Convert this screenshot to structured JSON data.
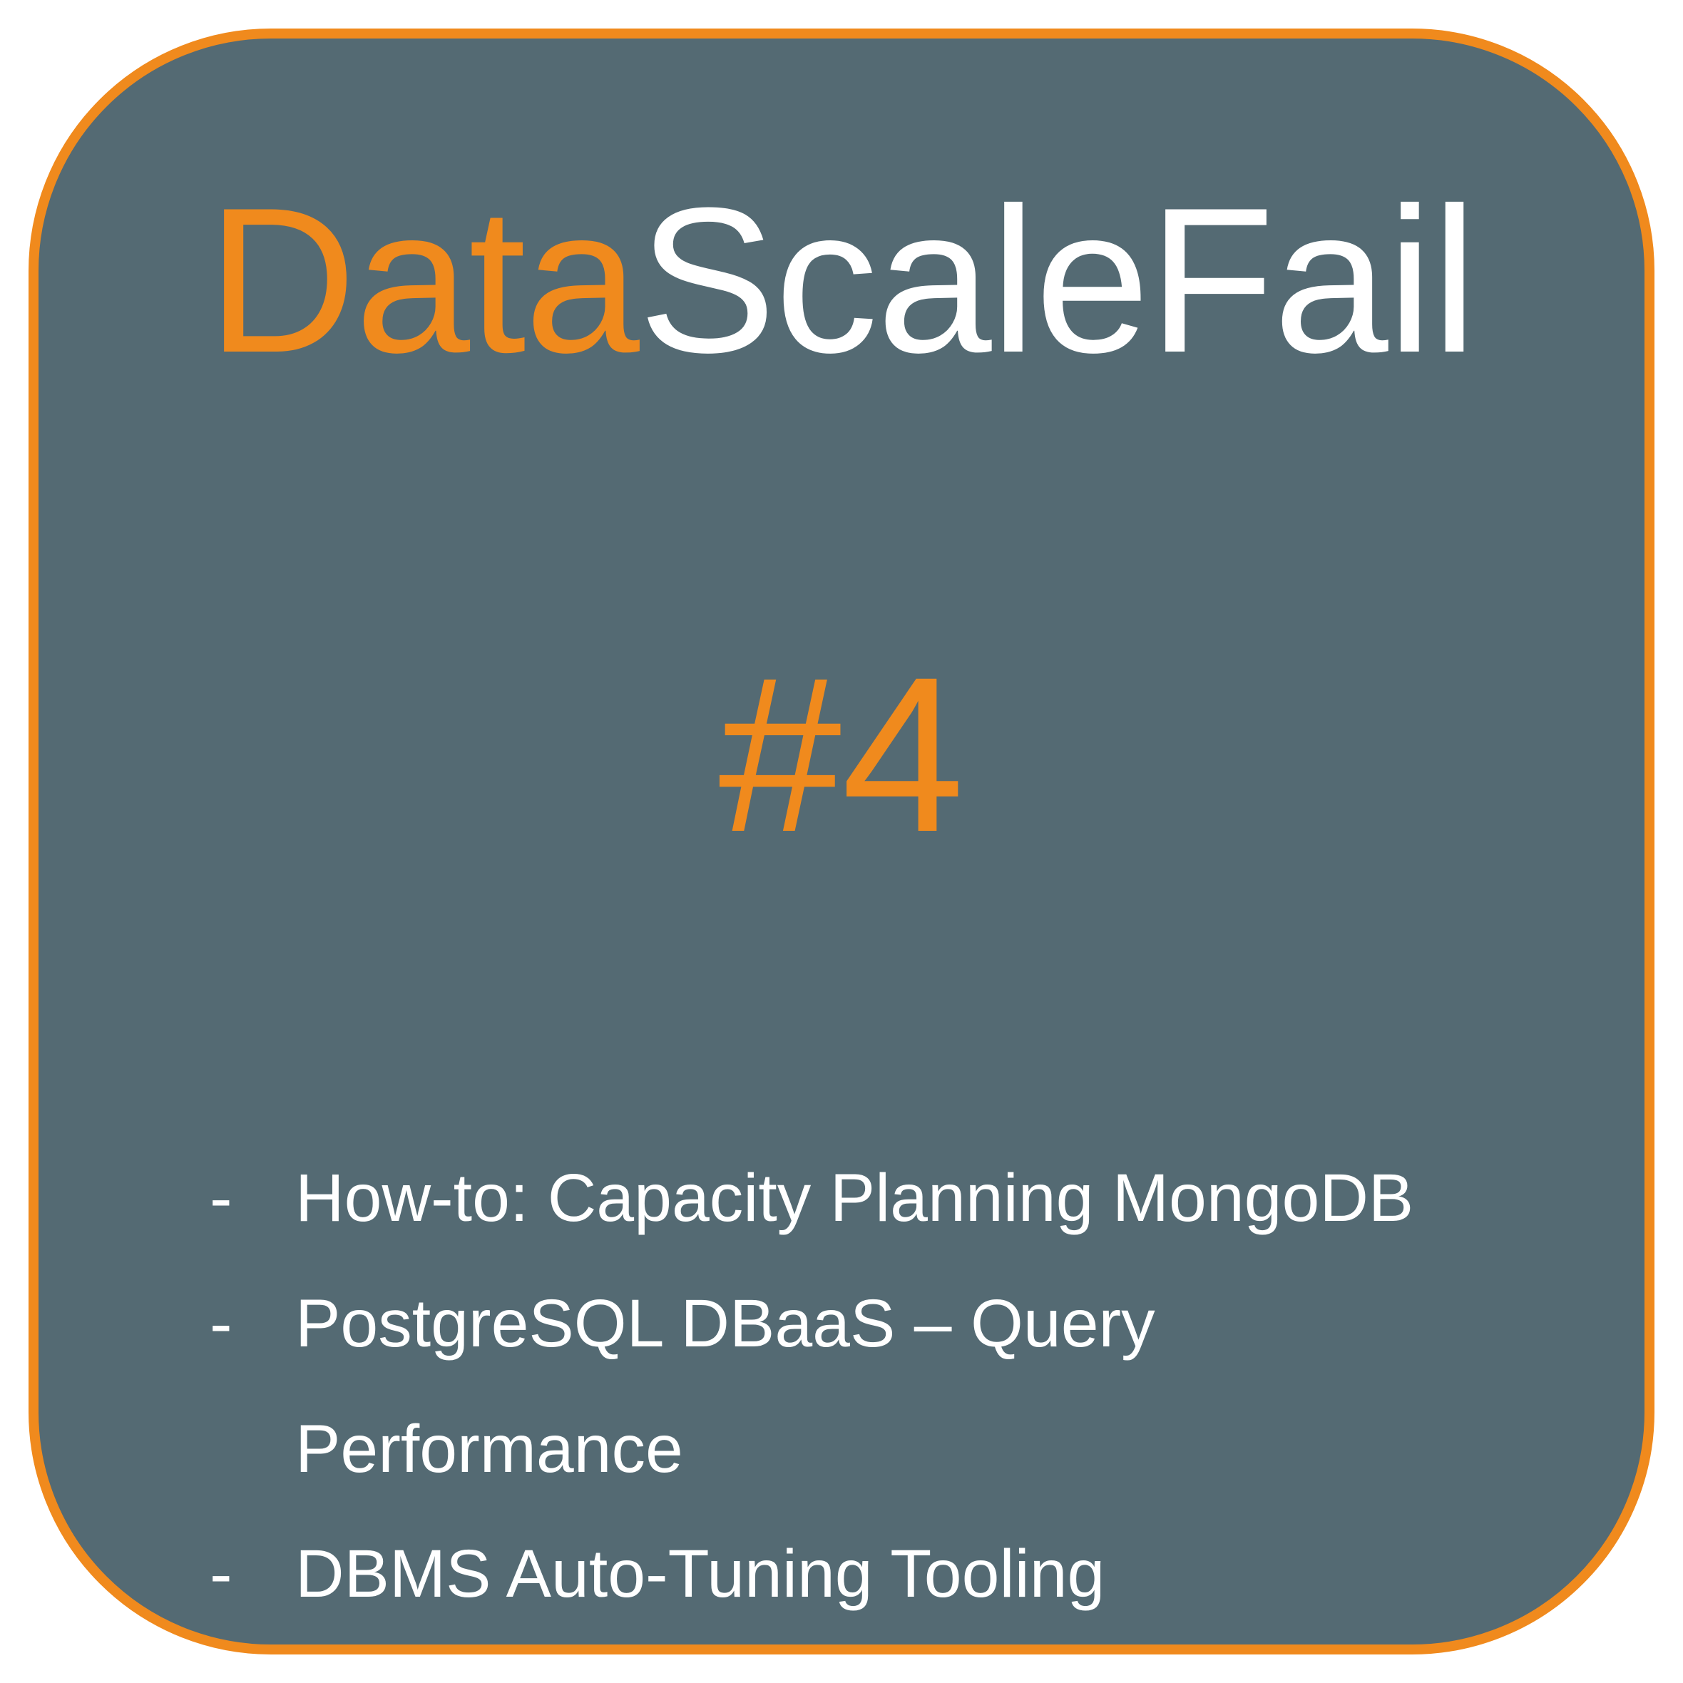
{
  "title": {
    "part1": "Data",
    "part2": "ScaleFail"
  },
  "issue_number": "#4",
  "topics": [
    "How-to: Capacity Planning MongoDB",
    "PostgreSQL DBaaS – Query Performance",
    "DBMS Auto-Tuning Tooling"
  ],
  "dash": "-"
}
